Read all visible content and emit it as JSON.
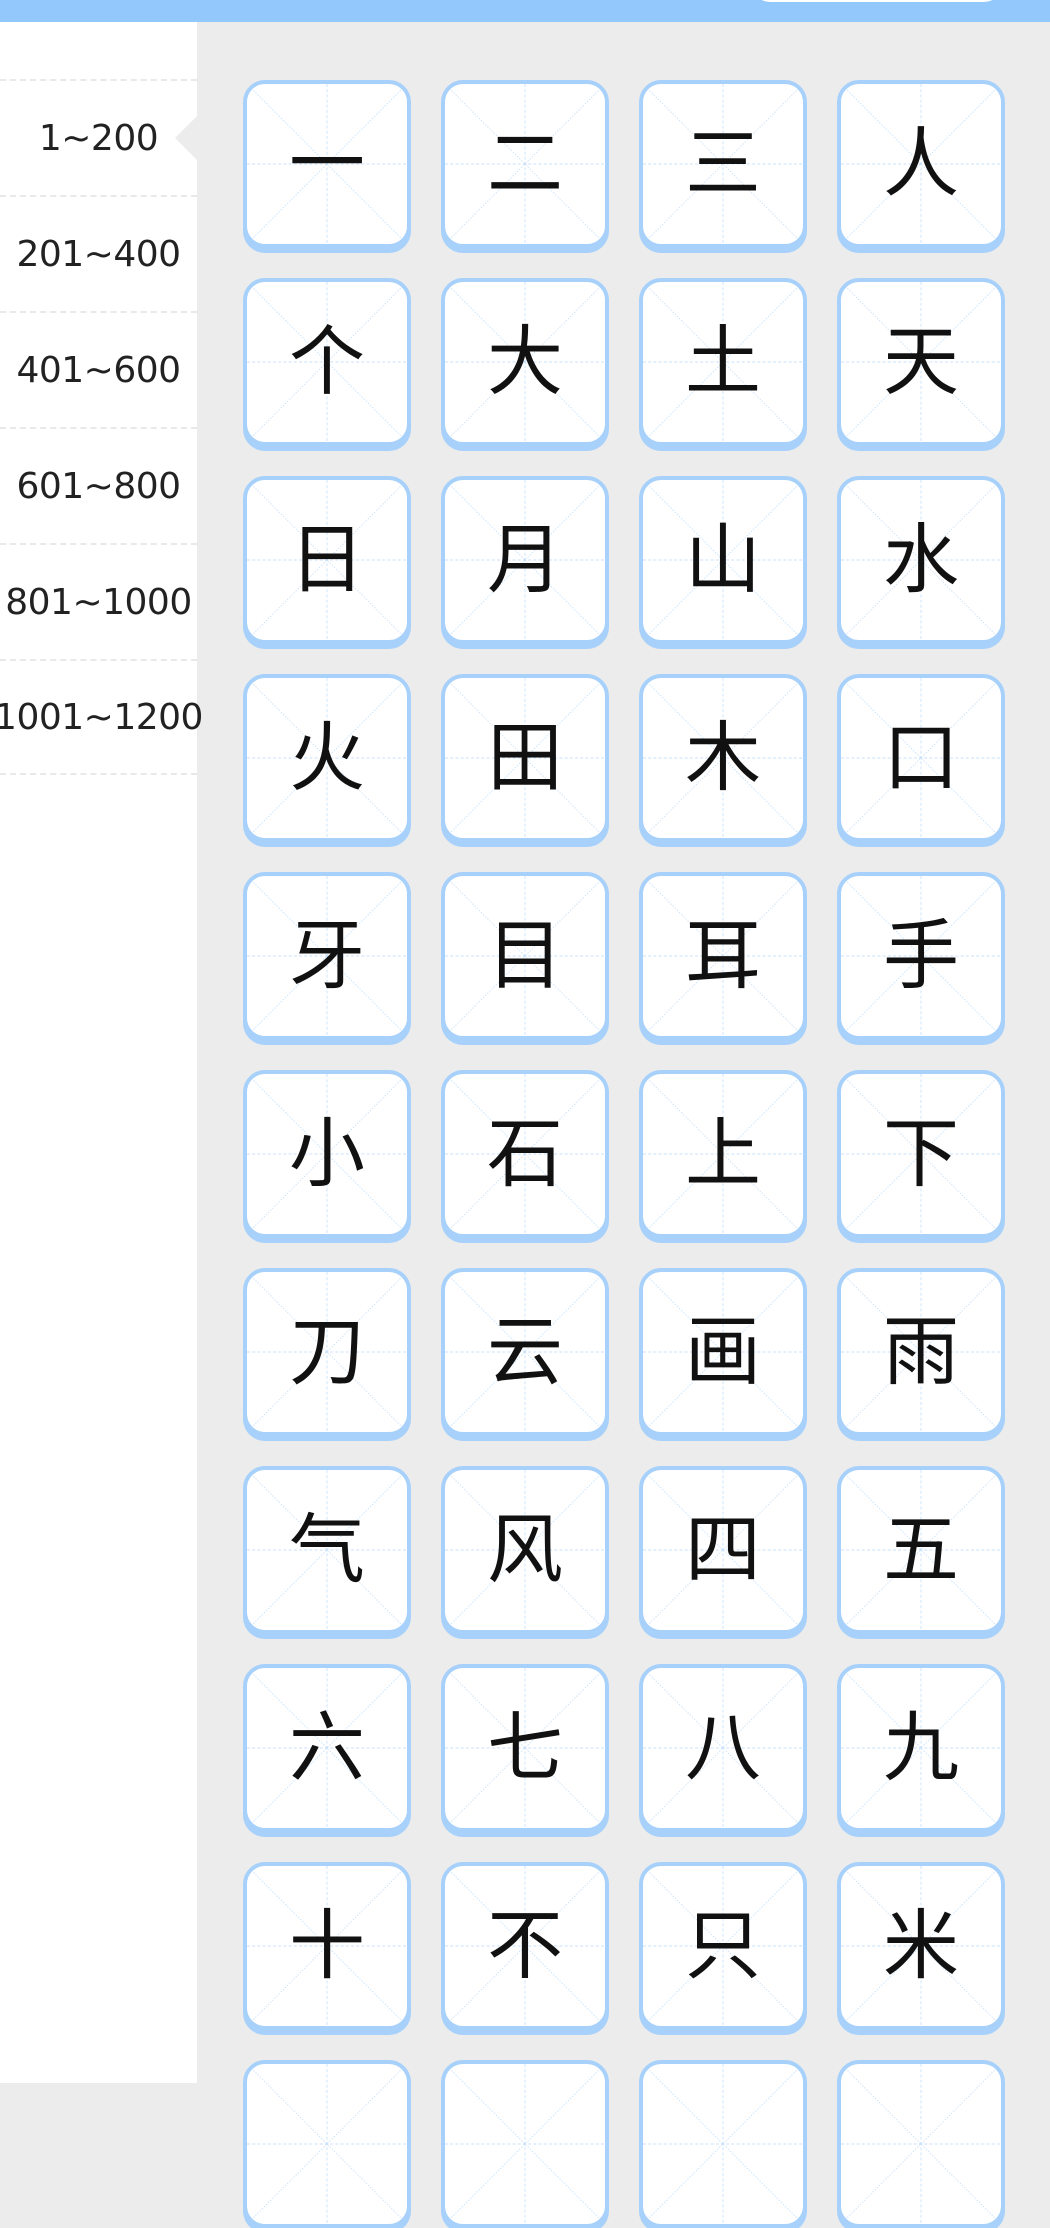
{
  "sidebar": {
    "items": [
      {
        "label": "1~200",
        "active": true
      },
      {
        "label": "201~400",
        "active": false
      },
      {
        "label": "401~600",
        "active": false
      },
      {
        "label": "601~800",
        "active": false
      },
      {
        "label": "801~1000",
        "active": false
      },
      {
        "label": "1001~1200",
        "active": false
      }
    ]
  },
  "characters": [
    "一",
    "二",
    "三",
    "人",
    "个",
    "大",
    "土",
    "天",
    "日",
    "月",
    "山",
    "水",
    "火",
    "田",
    "木",
    "口",
    "牙",
    "目",
    "耳",
    "手",
    "小",
    "石",
    "上",
    "下",
    "刀",
    "云",
    "画",
    "雨",
    "气",
    "风",
    "四",
    "五",
    "六",
    "七",
    "八",
    "九",
    "十",
    "不",
    "只",
    "米",
    "",
    "",
    "",
    ""
  ],
  "colors": {
    "accent": "#93c8fc",
    "tile_border": "#a7d1fb",
    "guide_line": "#c9e2fb",
    "background": "#ececec"
  }
}
